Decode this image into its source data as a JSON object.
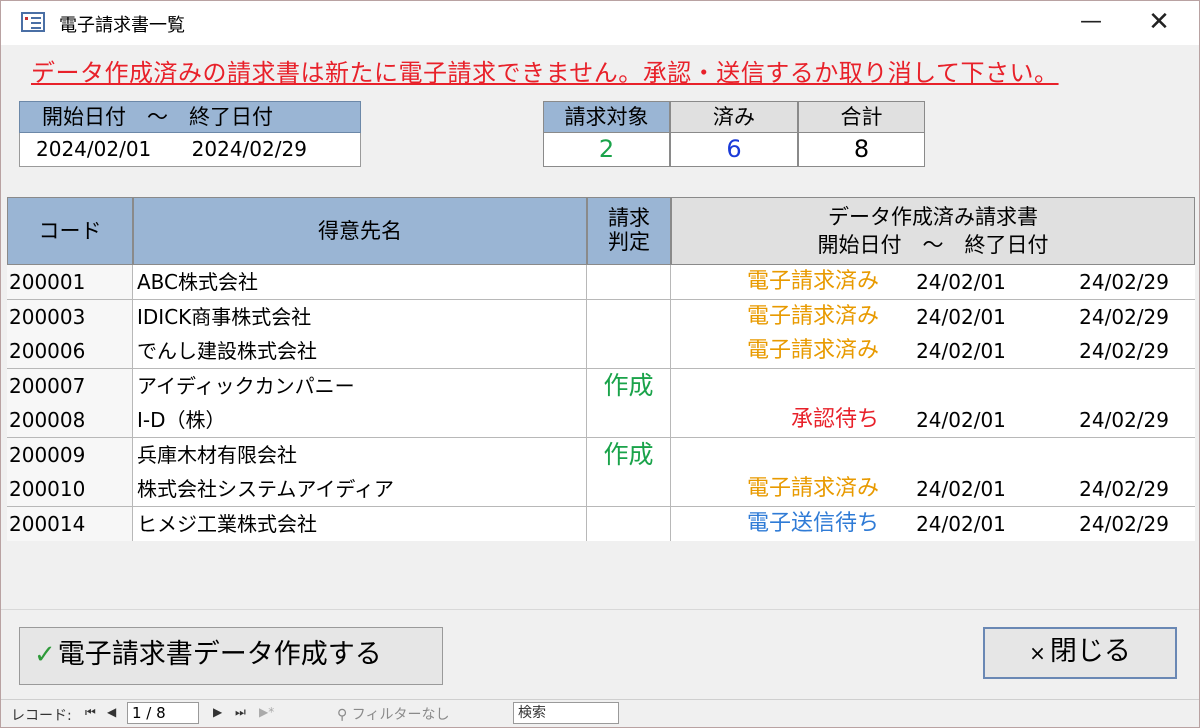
{
  "window": {
    "title": "電子請求書一覧",
    "minimize_glyph": "—",
    "close_glyph": "✕"
  },
  "warning": "データ作成済みの請求書は新たに電子請求できません。承認・送信するか取り消して下さい。",
  "date_range": {
    "header": "開始日付　～　終了日付",
    "start": "2024/02/01",
    "end": "2024/02/29"
  },
  "counts": {
    "target_label": "請求対象",
    "done_label": "済み",
    "total_label": "合計",
    "target": "2",
    "done": "6",
    "total": "8",
    "target_color": "#1aa34a",
    "done_color": "#1a3ad8",
    "total_color": "#000000"
  },
  "table": {
    "headers": {
      "code": "コード",
      "name": "得意先名",
      "judge_line1": "請求",
      "judge_line2": "判定",
      "range_line1": "データ作成済み請求書",
      "range_line2": "開始日付　～　終了日付"
    },
    "rows": [
      {
        "code": "200001",
        "name": "ABC株式会社",
        "judge": "",
        "status": "電子請求済み",
        "status_kind": "orange",
        "start": "24/02/01",
        "end": "24/02/29"
      },
      {
        "code": "200003",
        "name": "IDICK商事株式会社",
        "judge": "",
        "status": "電子請求済み",
        "status_kind": "orange",
        "start": "24/02/01",
        "end": "24/02/29"
      },
      {
        "code": "200006",
        "name": "でんし建設株式会社",
        "judge": "",
        "status": "電子請求済み",
        "status_kind": "orange",
        "start": "24/02/01",
        "end": "24/02/29"
      },
      {
        "code": "200007",
        "name": "アイディックカンパニー",
        "judge": "作成",
        "status": "",
        "status_kind": "",
        "start": "",
        "end": ""
      },
      {
        "code": "200008",
        "name": "I-D（株）",
        "judge": "",
        "status": "承認待ち",
        "status_kind": "red",
        "start": "24/02/01",
        "end": "24/02/29"
      },
      {
        "code": "200009",
        "name": "兵庫木材有限会社",
        "judge": "作成",
        "status": "",
        "status_kind": "",
        "start": "",
        "end": ""
      },
      {
        "code": "200010",
        "name": "株式会社システムアイディア",
        "judge": "",
        "status": "電子請求済み",
        "status_kind": "orange",
        "start": "24/02/01",
        "end": "24/02/29"
      },
      {
        "code": "200014",
        "name": "ヒメジ工業株式会社",
        "judge": "",
        "status": "電子送信待ち",
        "status_kind": "blue",
        "start": "24/02/01",
        "end": "24/02/29"
      }
    ]
  },
  "buttons": {
    "create_label": "電子請求書データ作成する",
    "create_icon": "✓",
    "close_label": "閉じる",
    "close_icon": "×"
  },
  "navigator": {
    "label": "レコード:",
    "first": "⏮",
    "prev": "◀",
    "position": "1 / 8",
    "next": "▶",
    "last": "⏭",
    "new": "▶*",
    "filter": "フィルターなし",
    "filter_icon": "⚲",
    "search_label": "検索"
  }
}
